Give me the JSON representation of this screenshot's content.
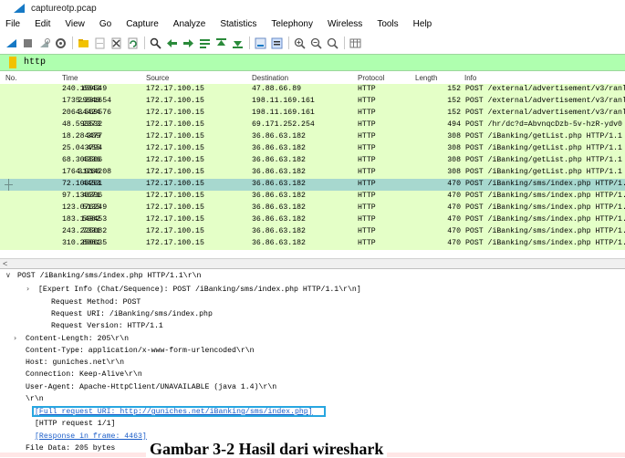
{
  "window": {
    "title": "captureotp.pcap",
    "logo": "wireshark-fin-icon"
  },
  "menu": [
    "File",
    "Edit",
    "View",
    "Go",
    "Capture",
    "Analyze",
    "Statistics",
    "Telephony",
    "Wireless",
    "Tools",
    "Help"
  ],
  "toolbar": {
    "icons": [
      "start-capture-icon",
      "stop-capture-icon",
      "restart-capture-icon",
      "capture-options-icon",
      "open-file-icon",
      "save-file-icon",
      "close-file-icon",
      "reload-file-icon",
      "find-packet-icon",
      "go-back-icon",
      "go-forward-icon",
      "go-to-packet-icon",
      "first-packet-icon",
      "last-packet-icon",
      "autoscroll-icon",
      "colorize-icon",
      "zoom-in-icon",
      "zoom-out-icon",
      "normal-size-icon",
      "resize-columns-icon"
    ]
  },
  "filter": {
    "value": "http",
    "color": "#afffaf"
  },
  "columns": [
    "No.",
    "Time",
    "Source",
    "Destination",
    "Protocol",
    "Length",
    "Info"
  ],
  "packets": [
    {
      "no": "6943",
      "time": "240.159549",
      "src": "172.17.100.15",
      "dst": "47.88.66.89",
      "proto": "HTTP",
      "len": "152",
      "info": "POST /external/advertisement/v3/ranl"
    },
    {
      "no": "29949",
      "time": "1735.231654",
      "src": "172.17.100.15",
      "dst": "198.11.169.161",
      "proto": "HTTP",
      "len": "152",
      "info": "POST /external/advertisement/v3/ranl"
    },
    {
      "no": "34424",
      "time": "2064.569576",
      "src": "172.17.100.15",
      "dst": "198.11.169.161",
      "proto": "HTTP",
      "len": "152",
      "info": "POST /external/advertisement/v3/ranl"
    },
    {
      "no": "2373",
      "time": "48.593532",
      "src": "172.17.100.15",
      "dst": "69.171.252.254",
      "proto": "HTTP",
      "len": "494",
      "info": "POST /hr/dc?d=AbvnqcDzb-5v-hzR-ydv0"
    },
    {
      "no": "309",
      "time": "18.284477",
      "src": "172.17.100.15",
      "dst": "36.86.63.182",
      "proto": "HTTP",
      "len": "308",
      "info": "POST /iBanking/getList.php HTTP/1.1"
    },
    {
      "no": "455",
      "time": "25.043794",
      "src": "172.17.100.15",
      "dst": "36.86.63.182",
      "proto": "HTTP",
      "len": "308",
      "info": "POST /iBanking/getList.php HTTP/1.1"
    },
    {
      "no": "4336",
      "time": "68.305506",
      "src": "172.17.100.15",
      "dst": "36.86.63.182",
      "proto": "HTTP",
      "len": "308",
      "info": "POST /iBanking/getList.php HTTP/1.1"
    },
    {
      "no": "31206",
      "time": "1764.914208",
      "src": "172.17.100.15",
      "dst": "36.86.63.182",
      "proto": "HTTP",
      "len": "308",
      "info": "POST /iBanking/getList.php HTTP/1.1"
    },
    {
      "no": "4453",
      "time": "72.106261",
      "src": "172.17.100.15",
      "dst": "36.86.63.182",
      "proto": "HTTP",
      "len": "470",
      "info": "POST /iBanking/sms/index.php HTTP/1.",
      "selected": true
    },
    {
      "no": "4671",
      "time": "97.136396",
      "src": "172.17.100.15",
      "dst": "36.86.63.182",
      "proto": "HTTP",
      "len": "470",
      "info": "POST /iBanking/sms/index.php HTTP/1."
    },
    {
      "no": "5135",
      "time": "123.076249",
      "src": "172.17.100.15",
      "dst": "36.86.63.182",
      "proto": "HTTP",
      "len": "470",
      "info": "POST /iBanking/sms/index.php HTTP/1."
    },
    {
      "no": "5982",
      "time": "183.143453",
      "src": "172.17.100.15",
      "dst": "36.86.63.182",
      "proto": "HTTP",
      "len": "470",
      "info": "POST /iBanking/sms/index.php HTTP/1."
    },
    {
      "no": "7331",
      "time": "243.225082",
      "src": "172.17.100.15",
      "dst": "36.86.63.182",
      "proto": "HTTP",
      "len": "470",
      "info": "POST /iBanking/sms/index.php HTTP/1."
    },
    {
      "no": "8081",
      "time": "310.250635",
      "src": "172.17.100.15",
      "dst": "36.86.63.182",
      "proto": "HTTP",
      "len": "470",
      "info": "POST /iBanking/sms/index.php HTTP/1."
    }
  ],
  "details": [
    {
      "text": "POST /iBanking/sms/index.php HTTP/1.1\\r\\n",
      "tri": "v",
      "color": "#000000"
    },
    {
      "text": "[Expert Info (Chat/Sequence): POST /iBanking/sms/index.php HTTP/1.1\\r\\n]",
      "tri": ">",
      "color": "#000000"
    },
    {
      "text": "Request Method: POST",
      "tri": "",
      "color": "#000000"
    },
    {
      "text": "Request URI: /iBanking/sms/index.php",
      "tri": "",
      "color": "#000000"
    },
    {
      "text": "Request Version: HTTP/1.1",
      "tri": "",
      "color": "#000000"
    },
    {
      "text": "Content-Length: 205\\r\\n",
      "tri": ">",
      "color": "#000000"
    },
    {
      "text": "Content-Type: application/x-www-form-urlencoded\\r\\n",
      "tri": "",
      "color": "#000000"
    },
    {
      "text": "Host: guniches.net\\r\\n",
      "tri": "",
      "color": "#000000"
    },
    {
      "text": "Connection: Keep-Alive\\r\\n",
      "tri": "",
      "color": "#000000"
    },
    {
      "text": "User-Agent: Apache-HttpClient/UNAVAILABLE (java 1.4)\\r\\n",
      "tri": "",
      "color": "#000000"
    },
    {
      "text": "\\r\\n",
      "tri": "",
      "color": "#000000"
    },
    {
      "text": "[Full request URI: http://guniches.net/iBanking/sms/index.php]",
      "tri": "",
      "color": "#1a5cc8",
      "link": true
    },
    {
      "text": "[HTTP request 1/1]",
      "tri": "",
      "color": "#000000"
    },
    {
      "text": "[Response in frame: 4463]",
      "tri": "",
      "color": "#1a5cc8",
      "link": true
    },
    {
      "text": "File Data: 205 bytes",
      "tri": "",
      "color": "#000000"
    }
  ],
  "caption": "Gambar 3-2 Hasil dari wireshark",
  "colors": {
    "row_bg": "#e4ffc7",
    "row_selected": "#a7d8cf",
    "highlight_box": "#27a6e0",
    "link": "#1a5cc8"
  }
}
